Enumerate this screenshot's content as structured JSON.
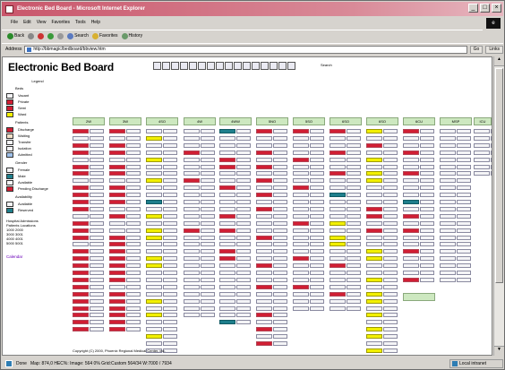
{
  "window": {
    "title": "Electronic Bed Board - Microsoft Internet Explorer",
    "min": "_",
    "max": "□",
    "close": "×"
  },
  "menu": [
    "File",
    "Edit",
    "View",
    "Favorites",
    "Tools",
    "Help"
  ],
  "toolbar": {
    "back": "Back",
    "forward": "",
    "search": "Search",
    "favorites": "Favorites",
    "history": "History"
  },
  "address": {
    "label": "Address",
    "url": "http://bbmagic/bedboard/bbview.htm",
    "go": "Go",
    "links": "Links"
  },
  "page": {
    "title": "Electronic Bed Board",
    "unit_label": "Search",
    "copyright": "Copyright (C) 2000, Phoenix Regional Medical Center, Inc."
  },
  "legend": {
    "heading": "Legend",
    "beds_heading": "Beds",
    "bed_types": [
      {
        "label": "Vacant",
        "color": "#f4f4f6"
      },
      {
        "label": "Private",
        "color": "#d11e33"
      },
      {
        "label": "Semi",
        "color": "#d11e33"
      },
      {
        "label": "Ward",
        "color": "#f2f000"
      }
    ],
    "patients_heading": "Patients",
    "patient_types": [
      {
        "label": "Discharge",
        "color": "#d11e33"
      },
      {
        "label": "Waiting",
        "color": "#f2e0c8"
      },
      {
        "label": "Transfer",
        "color": "#f4f4f6"
      },
      {
        "label": "Isolation",
        "color": "#f4f4f6"
      },
      {
        "label": "Admitted",
        "color": "#9ec0e8"
      }
    ],
    "gender_heading": "Gender",
    "gender_types": [
      {
        "label": "Female",
        "color": "#f4f4f6"
      },
      {
        "label": "Male",
        "color": "#1e7f8c"
      },
      {
        "label": "Available",
        "color": "#f4f4f6"
      },
      {
        "label": "Pending Discharge",
        "color": "#d11e33"
      }
    ],
    "availability_heading": "Availability",
    "availability_types": [
      {
        "label": "Available",
        "color": "#f4f4f6"
      },
      {
        "label": "Reserved",
        "color": "#1e7f8c"
      }
    ],
    "pre": [
      "Hospital Admissions",
      "Patients Locations",
      "   1000  2000",
      "   3000  3001",
      "   4000  4001",
      "   5000  5001"
    ],
    "calendar": "Calendar"
  },
  "units": [
    "2W",
    "3W",
    "4SO",
    "4W",
    "4WW",
    "5NO",
    "5SO",
    "6SO",
    "6SO",
    "6CU",
    "MSP",
    "ICU"
  ],
  "status": {
    "left": "Done",
    "zone": "Local intranet",
    "coords": "Map: 874,0   HEC%: Image: 564   0%   Grid:Custom   564/34  W:7000 / 7934"
  },
  "colors": {
    "private": "#d11e33",
    "vacant": "#f4f4f6",
    "ward": "#f2f000",
    "reserved": "#1e7f8c",
    "unit_header": "#cde8c0"
  }
}
